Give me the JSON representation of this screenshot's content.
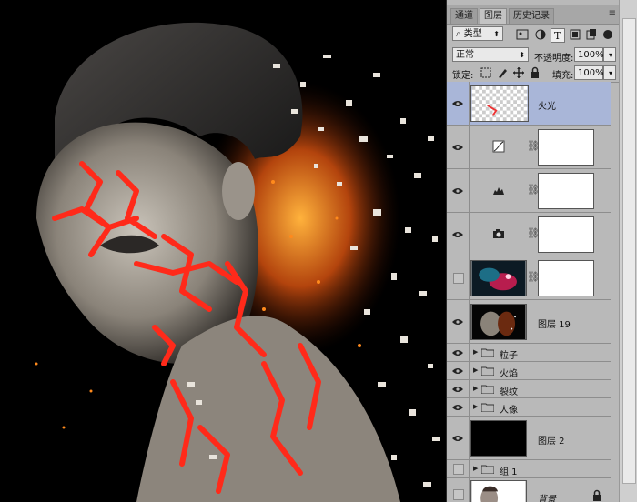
{
  "panel": {
    "tabs": [
      "通道",
      "图层",
      "历史记录"
    ],
    "active_tab": "图层",
    "menu_glyph": "≡",
    "filter": {
      "value": "类型"
    },
    "blend_mode": {
      "value": "正常"
    },
    "opacity": {
      "label": "不透明度:",
      "value": "100%"
    },
    "lock": {
      "label": "锁定:"
    },
    "fill": {
      "label": "填充:",
      "value": "100%"
    }
  },
  "layers": [
    {
      "name": "火光",
      "kind": "image",
      "visible": true,
      "selected": true
    },
    {
      "name": "",
      "kind": "adjustment-curves",
      "visible": true
    },
    {
      "name": "",
      "kind": "adjustment-levels",
      "visible": true
    },
    {
      "name": "",
      "kind": "adjustment-camera",
      "visible": true
    },
    {
      "name": "",
      "kind": "image-masked",
      "visible": false
    },
    {
      "name": "图层 19",
      "kind": "image",
      "visible": true
    },
    {
      "name": "粒子",
      "kind": "group",
      "visible": true
    },
    {
      "name": "火焰",
      "kind": "group",
      "visible": true
    },
    {
      "name": "裂纹",
      "kind": "group",
      "visible": true
    },
    {
      "name": "人像",
      "kind": "group",
      "visible": true
    },
    {
      "name": "图层 2",
      "kind": "fill-black",
      "visible": true
    },
    {
      "name": "组 1",
      "kind": "group",
      "visible": false
    },
    {
      "name": "背景",
      "kind": "background",
      "visible": false
    }
  ],
  "colors": {
    "panel_bg": "#b9b9b9",
    "selected": "#a9b6d8",
    "crack_red": "#ff2a1a"
  }
}
